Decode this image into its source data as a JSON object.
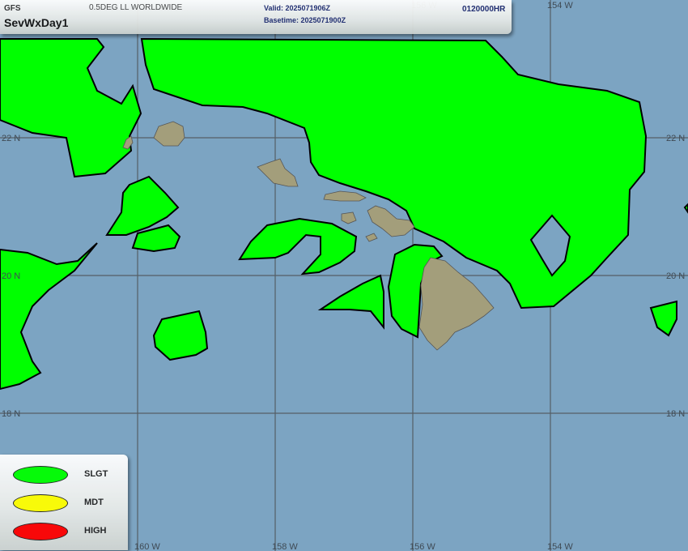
{
  "header": {
    "model": "GFS",
    "product": "SevWxDay1",
    "grid": "0.5DEG LL WORLDWIDE",
    "valid": "Valid: 2025071906Z",
    "basetime": "Basetime: 2025071900Z",
    "forecast_hour": "0120000HR"
  },
  "grid_labels": {
    "lat_22": "22 N",
    "lat_20": "20 N",
    "lat_18": "18 N",
    "lon_160": "160 W",
    "lon_158": "158 W",
    "lon_156": "156 W",
    "lon_154": "154 W"
  },
  "legend": [
    {
      "label": "SLGT",
      "color": "#00ff00"
    },
    {
      "label": "MDT",
      "color": "#ffff00"
    },
    {
      "label": "HIGH",
      "color": "#ff0000"
    }
  ],
  "colors": {
    "ocean": "#7ca4c2",
    "slight_risk": "#00ff00",
    "land": "#a39e7b",
    "grid": "#555e66"
  }
}
